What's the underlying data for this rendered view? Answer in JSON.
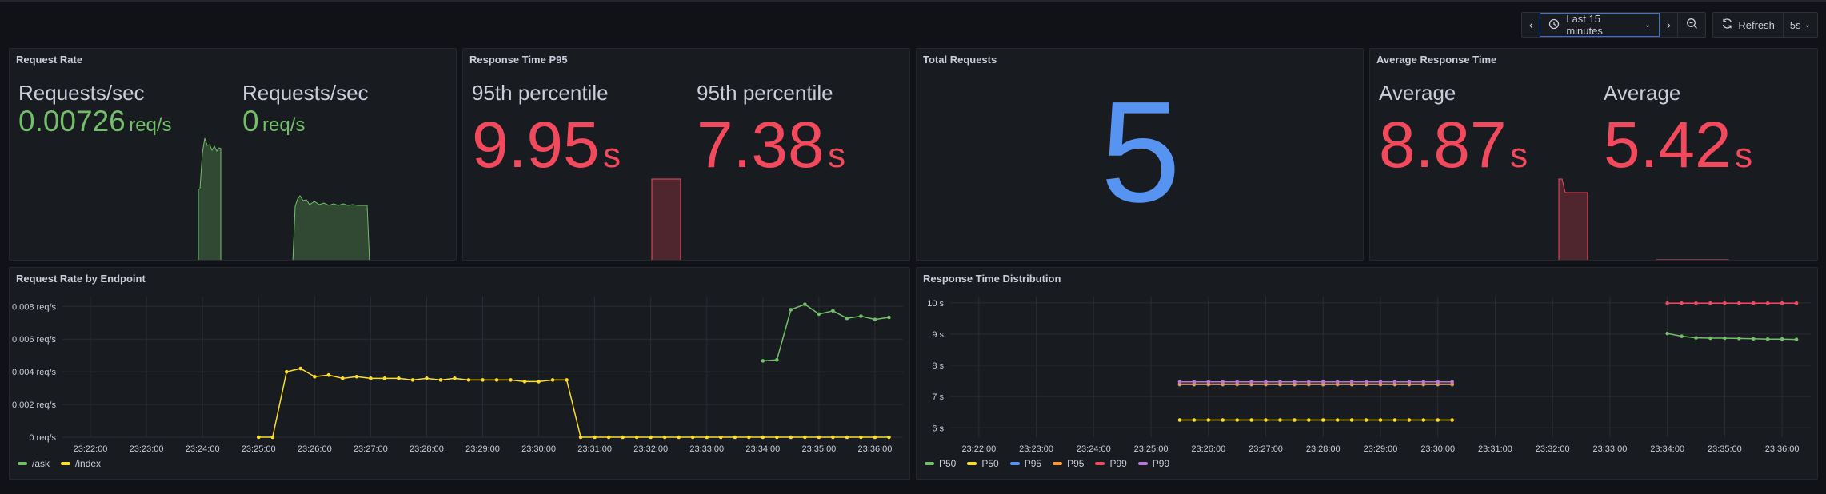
{
  "toolbar": {
    "time_range": "Last 15 minutes",
    "refresh_label": "Refresh",
    "refresh_interval": "5s"
  },
  "panels": {
    "request_rate": {
      "title": "Request Rate",
      "stats": [
        {
          "label": "Requests/sec",
          "value": "0.00726",
          "unit": "req/s"
        },
        {
          "label": "Requests/sec",
          "value": "0",
          "unit": "req/s"
        }
      ]
    },
    "response_p95": {
      "title": "Response Time P95",
      "stats": [
        {
          "label": "95th percentile",
          "value": "9.95",
          "unit": "s"
        },
        {
          "label": "95th percentile",
          "value": "7.38",
          "unit": "s"
        }
      ]
    },
    "total_requests": {
      "title": "Total Requests",
      "value": "5"
    },
    "avg_response": {
      "title": "Average Response Time",
      "stats": [
        {
          "label": "Average",
          "value": "8.87",
          "unit": "s"
        },
        {
          "label": "Average",
          "value": "5.42",
          "unit": "s"
        }
      ]
    },
    "rate_by_endpoint": {
      "title": "Request Rate by Endpoint",
      "legend": [
        {
          "name": "/ask",
          "color": "#73bf69"
        },
        {
          "name": "/index",
          "color": "#fade2a"
        }
      ]
    },
    "response_dist": {
      "title": "Response Time Distribution",
      "legend": [
        {
          "name": "P50",
          "color": "#73bf69"
        },
        {
          "name": "P50",
          "color": "#fade2a"
        },
        {
          "name": "P95",
          "color": "#5794f2"
        },
        {
          "name": "P95",
          "color": "#ff9830"
        },
        {
          "name": "P99",
          "color": "#f2495c"
        },
        {
          "name": "P99",
          "color": "#b877d9"
        }
      ]
    }
  },
  "chart_data": [
    {
      "type": "line",
      "title": "Request Rate by Endpoint",
      "x_ticks": [
        "23:22:00",
        "23:23:00",
        "23:24:00",
        "23:25:00",
        "23:26:00",
        "23:27:00",
        "23:28:00",
        "23:29:00",
        "23:30:00",
        "23:31:00",
        "23:32:00",
        "23:33:00",
        "23:34:00",
        "23:35:00",
        "23:36:00"
      ],
      "y_ticks": [
        "0 req/s",
        "0.002 req/s",
        "0.004 req/s",
        "0.006 req/s",
        "0.008 req/s"
      ],
      "xlim": [
        "23:21:30",
        "23:36:30"
      ],
      "ylim": [
        0,
        0.0086
      ],
      "series": [
        {
          "name": "/ask",
          "color": "#73bf69",
          "x": [
            "23:34:00",
            "23:34:15",
            "23:34:30",
            "23:34:45",
            "23:35:00",
            "23:35:15",
            "23:35:30",
            "23:35:45",
            "23:36:00",
            "23:36:15"
          ],
          "values": [
            0.00467,
            0.00473,
            0.0078,
            0.00813,
            0.00753,
            0.00773,
            0.00727,
            0.0074,
            0.0072,
            0.00733
          ]
        },
        {
          "name": "/index",
          "color": "#fade2a",
          "x": [
            "23:25:00",
            "23:25:15",
            "23:25:30",
            "23:25:45",
            "23:26:00",
            "23:26:15",
            "23:26:30",
            "23:26:45",
            "23:27:00",
            "23:27:15",
            "23:27:30",
            "23:27:45",
            "23:28:00",
            "23:28:15",
            "23:28:30",
            "23:28:45",
            "23:29:00",
            "23:29:15",
            "23:29:30",
            "23:29:45",
            "23:30:00",
            "23:30:15",
            "23:30:30",
            "23:30:45",
            "23:31:00",
            "23:31:15",
            "23:31:30",
            "23:31:45",
            "23:32:00",
            "23:32:15",
            "23:32:30",
            "23:32:45",
            "23:33:00",
            "23:33:15",
            "23:33:30",
            "23:33:45",
            "23:34:00",
            "23:34:15",
            "23:34:30",
            "23:34:45",
            "23:35:00",
            "23:35:15",
            "23:35:30",
            "23:35:45",
            "23:36:00",
            "23:36:15"
          ],
          "values": [
            0,
            0,
            0.004,
            0.0042,
            0.0037,
            0.0038,
            0.0036,
            0.0037,
            0.0036,
            0.0036,
            0.0036,
            0.0035,
            0.0036,
            0.0035,
            0.0036,
            0.0035,
            0.0035,
            0.0035,
            0.0035,
            0.0034,
            0.0034,
            0.0035,
            0.0035,
            0,
            0,
            0,
            0,
            0,
            0,
            0,
            0,
            0,
            0,
            0,
            0,
            0,
            0,
            0,
            0,
            0,
            0,
            0,
            0,
            0,
            0,
            0
          ]
        }
      ],
      "legend_placement": "bottom-left",
      "grid": true
    },
    {
      "type": "line",
      "title": "Response Time Distribution",
      "x_ticks": [
        "23:22:00",
        "23:23:00",
        "23:24:00",
        "23:25:00",
        "23:26:00",
        "23:27:00",
        "23:28:00",
        "23:29:00",
        "23:30:00",
        "23:31:00",
        "23:32:00",
        "23:33:00",
        "23:34:00",
        "23:35:00",
        "23:36:00"
      ],
      "y_ticks": [
        "6 s",
        "7 s",
        "8 s",
        "9 s",
        "10 s"
      ],
      "xlim": [
        "23:21:30",
        "23:36:30"
      ],
      "ylim": [
        5.7,
        10.2
      ],
      "series": [
        {
          "name": "P50",
          "color": "#73bf69",
          "x": [
            "23:34:00",
            "23:34:15",
            "23:34:30",
            "23:34:45",
            "23:35:00",
            "23:35:15",
            "23:35:30",
            "23:35:45",
            "23:36:00",
            "23:36:15"
          ],
          "values": [
            9.02,
            8.93,
            8.88,
            8.87,
            8.87,
            8.86,
            8.85,
            8.84,
            8.84,
            8.83
          ]
        },
        {
          "name": "P50",
          "color": "#fade2a",
          "x": [
            "23:25:30",
            "23:25:45",
            "23:26:00",
            "23:26:15",
            "23:26:30",
            "23:26:45",
            "23:27:00",
            "23:27:15",
            "23:27:30",
            "23:27:45",
            "23:28:00",
            "23:28:15",
            "23:28:30",
            "23:28:45",
            "23:29:00",
            "23:29:15",
            "23:29:30",
            "23:29:45",
            "23:30:00",
            "23:30:15"
          ],
          "values": [
            6.25,
            6.25,
            6.25,
            6.25,
            6.25,
            6.25,
            6.25,
            6.25,
            6.25,
            6.25,
            6.25,
            6.25,
            6.25,
            6.25,
            6.25,
            6.25,
            6.25,
            6.25,
            6.25,
            6.25
          ]
        },
        {
          "name": "P95",
          "color": "#5794f2",
          "x": [
            "23:25:30",
            "23:25:45",
            "23:26:00",
            "23:26:15",
            "23:26:30",
            "23:26:45",
            "23:27:00",
            "23:27:15",
            "23:27:30",
            "23:27:45",
            "23:28:00",
            "23:28:15",
            "23:28:30",
            "23:28:45",
            "23:29:00",
            "23:29:15",
            "23:29:30",
            "23:29:45",
            "23:30:00",
            "23:30:15"
          ],
          "values": [
            7.38,
            7.38,
            7.38,
            7.38,
            7.38,
            7.38,
            7.38,
            7.38,
            7.38,
            7.38,
            7.38,
            7.38,
            7.38,
            7.38,
            7.38,
            7.38,
            7.38,
            7.38,
            7.38,
            7.38
          ]
        },
        {
          "name": "P95",
          "color": "#ff9830",
          "x": [
            "23:25:30",
            "23:25:45",
            "23:26:00",
            "23:26:15",
            "23:26:30",
            "23:26:45",
            "23:27:00",
            "23:27:15",
            "23:27:30",
            "23:27:45",
            "23:28:00",
            "23:28:15",
            "23:28:30",
            "23:28:45",
            "23:29:00",
            "23:29:15",
            "23:29:30",
            "23:29:45",
            "23:30:00",
            "23:30:15"
          ],
          "values": [
            7.4,
            7.4,
            7.4,
            7.4,
            7.4,
            7.4,
            7.4,
            7.4,
            7.4,
            7.4,
            7.4,
            7.4,
            7.4,
            7.4,
            7.4,
            7.4,
            7.4,
            7.4,
            7.4,
            7.4
          ]
        },
        {
          "name": "P99",
          "color": "#f2495c",
          "x": [
            "23:34:00",
            "23:34:15",
            "23:34:30",
            "23:34:45",
            "23:35:00",
            "23:35:15",
            "23:35:30",
            "23:35:45",
            "23:36:00",
            "23:36:15"
          ],
          "values": [
            9.99,
            9.99,
            9.99,
            9.99,
            9.99,
            9.99,
            9.99,
            9.99,
            9.99,
            9.99
          ]
        },
        {
          "name": "P99",
          "color": "#b877d9",
          "x": [
            "23:25:30",
            "23:25:45",
            "23:26:00",
            "23:26:15",
            "23:26:30",
            "23:26:45",
            "23:27:00",
            "23:27:15",
            "23:27:30",
            "23:27:45",
            "23:28:00",
            "23:28:15",
            "23:28:30",
            "23:28:45",
            "23:29:00",
            "23:29:15",
            "23:29:30",
            "23:29:45",
            "23:30:00",
            "23:30:15"
          ],
          "values": [
            7.47,
            7.47,
            7.47,
            7.47,
            7.47,
            7.47,
            7.47,
            7.47,
            7.47,
            7.47,
            7.47,
            7.47,
            7.47,
            7.47,
            7.47,
            7.47,
            7.47,
            7.47,
            7.47,
            7.47
          ]
        }
      ],
      "legend_placement": "bottom-left",
      "grid": true
    }
  ]
}
